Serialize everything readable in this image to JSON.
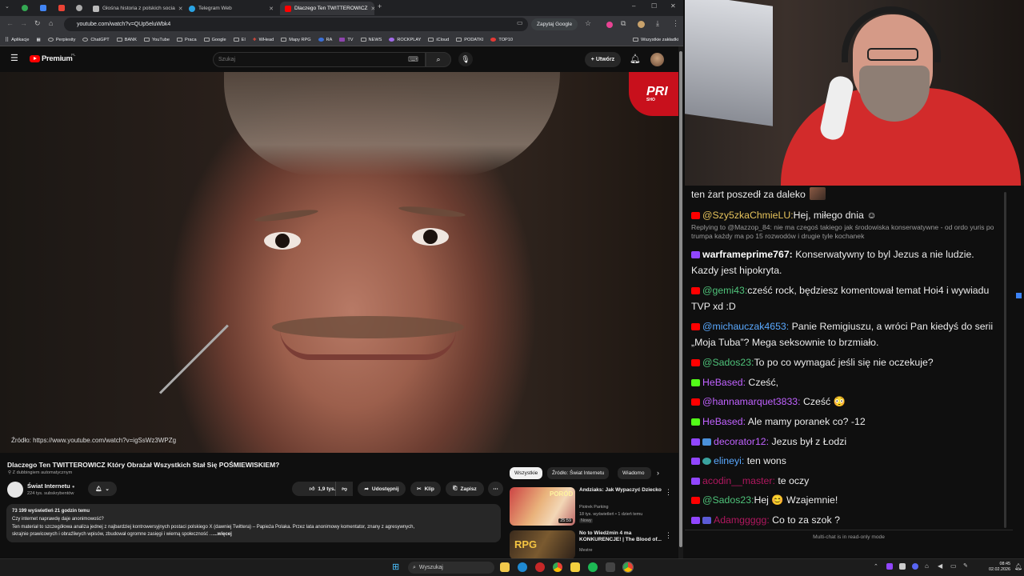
{
  "browser": {
    "tabs": [
      {
        "label": "Głośna historia z polskich socia",
        "active": false
      },
      {
        "label": "Telegram Web",
        "active": false
      },
      {
        "label": "Dlaczego Ten TWITTEROWICZ",
        "active": true
      }
    ],
    "url": "youtube.com/watch?v=QUp5eluWbk4",
    "ask_google": "Zapytaj Google",
    "bookmarks": [
      "Aplikacje",
      "Perplexity",
      "ChatGPT",
      "BANK",
      "YouTube",
      "Praca",
      "Google",
      "EI",
      "WHead",
      "Mapy RPG",
      "RA",
      "TV",
      "NEWS",
      "ROCKPLAY",
      "iCloud",
      "PODATKI",
      "TOP10"
    ],
    "all_bookmarks": "Wszystkie zakładki"
  },
  "youtube": {
    "logo": "Premium",
    "logo_sup": "PL",
    "search_placeholder": "Szukaj",
    "create_label": "Utwórz",
    "video": {
      "overlay_badge": "PRI",
      "overlay_badge_sub": "SHO",
      "source_text": "Źródło: https://www.youtube.com/watch?v=igSsWz3WPZg"
    },
    "title": "Dlaczego Ten TWITTEROWICZ Który Obrażał Wszystkich Stał Się POŚMIEWISKIEM?",
    "dubbing": "Z dubbingiem automatycznym",
    "channel": {
      "name": "Świat Internetu",
      "subs": "224 tys. subskrybentów"
    },
    "actions": {
      "likes": "1,9 tys.",
      "share": "Udostępnij",
      "clip": "Klip",
      "save": "Zapisz"
    },
    "description": {
      "stats": "73 199 wyświetleń  21 godzin temu",
      "line1": "Czy internet naprawdę daje anonimowość?",
      "line2": "Ten materiał to szczegółowa analiza jednej z najbardziej kontrowersyjnych postaci polskiego X (dawniej Twittera) – Papieża Polaka. Przez lata anonimowy komentator, znany z agresywnych,",
      "line3": "skrajnie prawicowych i obraźliwych wpisów, zbudował ogromne zasięgi i wierną społeczność  ...",
      "more": "...więcej"
    },
    "chips": [
      "Wszystkie",
      "Źródło: Świat Internetu",
      "Wiadomo"
    ],
    "recommendations": [
      {
        "title": "Andziaks: Jak Wypaczyć Dziecko",
        "channel": "Piotrek Parking",
        "meta": "18 tys. wyświetleń • 1 dzień temu",
        "badge": "Nowy",
        "duration": "25:59",
        "thumb_text": "PORÓD"
      },
      {
        "title": "No to Wiedźmin 4 ma KONKURENCJE! | The Blood of...",
        "channel": "Mestre",
        "meta": "",
        "badge": "",
        "duration": "",
        "thumb_text": "RPG"
      }
    ]
  },
  "chat": {
    "messages": [
      {
        "platform": "none",
        "user": "",
        "user_color": "#ececec",
        "text": "ten żart poszedł za daleko"
      },
      {
        "platform": "yt",
        "user": "@Szy5zkaChmieLU:",
        "user_color": "#e6c35c",
        "text": "Hej, miłego dnia ☺",
        "reply": "Replying to @Mazzop_84: nie ma czegoś takiego jak środowiska konserwatywne - od ordo yuris po trumpa każdy ma po 15 rozwodów i drugie tyle kochanek"
      },
      {
        "platform": "tw",
        "user": "warframeprime767:",
        "user_color": "#ffffff",
        "text": " Konserwatywny to byl Jezus a nie ludzie. Kazdy jest hipokryta."
      },
      {
        "platform": "yt",
        "user": "@gemi43:",
        "user_color": "#4fc37a",
        "text": "cześć rock, będziesz komentował temat Hoi4 i wywiadu TVP xd :D"
      },
      {
        "platform": "yt",
        "user": "@michauczak4653:",
        "user_color": "#5aa9ff",
        "text": " Panie Remigiuszu, a wróci Pan kiedyś do serii „Moja Tuba”? Mega seksownie to brzmiało."
      },
      {
        "platform": "yt",
        "user": "@Sados23:",
        "user_color": "#4fc37a",
        "text": "To po co wymagać jeśli się nie oczekuje?"
      },
      {
        "platform": "kk",
        "user": "HeBased:",
        "user_color": "#c062ff",
        "text": " Cześć,"
      },
      {
        "platform": "yt",
        "user": "@hannamarquet3833:",
        "user_color": "#c062ff",
        "text": " Cześć 😳"
      },
      {
        "platform": "kk",
        "user": "HeBased:",
        "user_color": "#c062ff",
        "text": " Ale mamy poranek co? -12"
      },
      {
        "platform": "tw",
        "user": "decorator12:",
        "user_color": "#c062ff",
        "text": " Jezus był z Łodzi"
      },
      {
        "platform": "tw",
        "user": "elineyi:",
        "user_color": "#5aa9ff",
        "text": " ten wons"
      },
      {
        "platform": "tw",
        "user": "acodin__master:",
        "user_color": "#b0175f",
        "text": " te oczy"
      },
      {
        "platform": "yt",
        "user": "@Sados23:",
        "user_color": "#4fc37a",
        "text": "Hej 😊 Wzajemnie!"
      },
      {
        "platform": "tw",
        "user": "Adamggggg:",
        "user_color": "#b0175f",
        "text": " Co to za szok ?"
      }
    ],
    "readonly_note": "Multi-chat is in read-only mode"
  },
  "taskbar": {
    "search_label": "Wyszukaj",
    "time": "08:45",
    "date": "02.02.2026"
  }
}
